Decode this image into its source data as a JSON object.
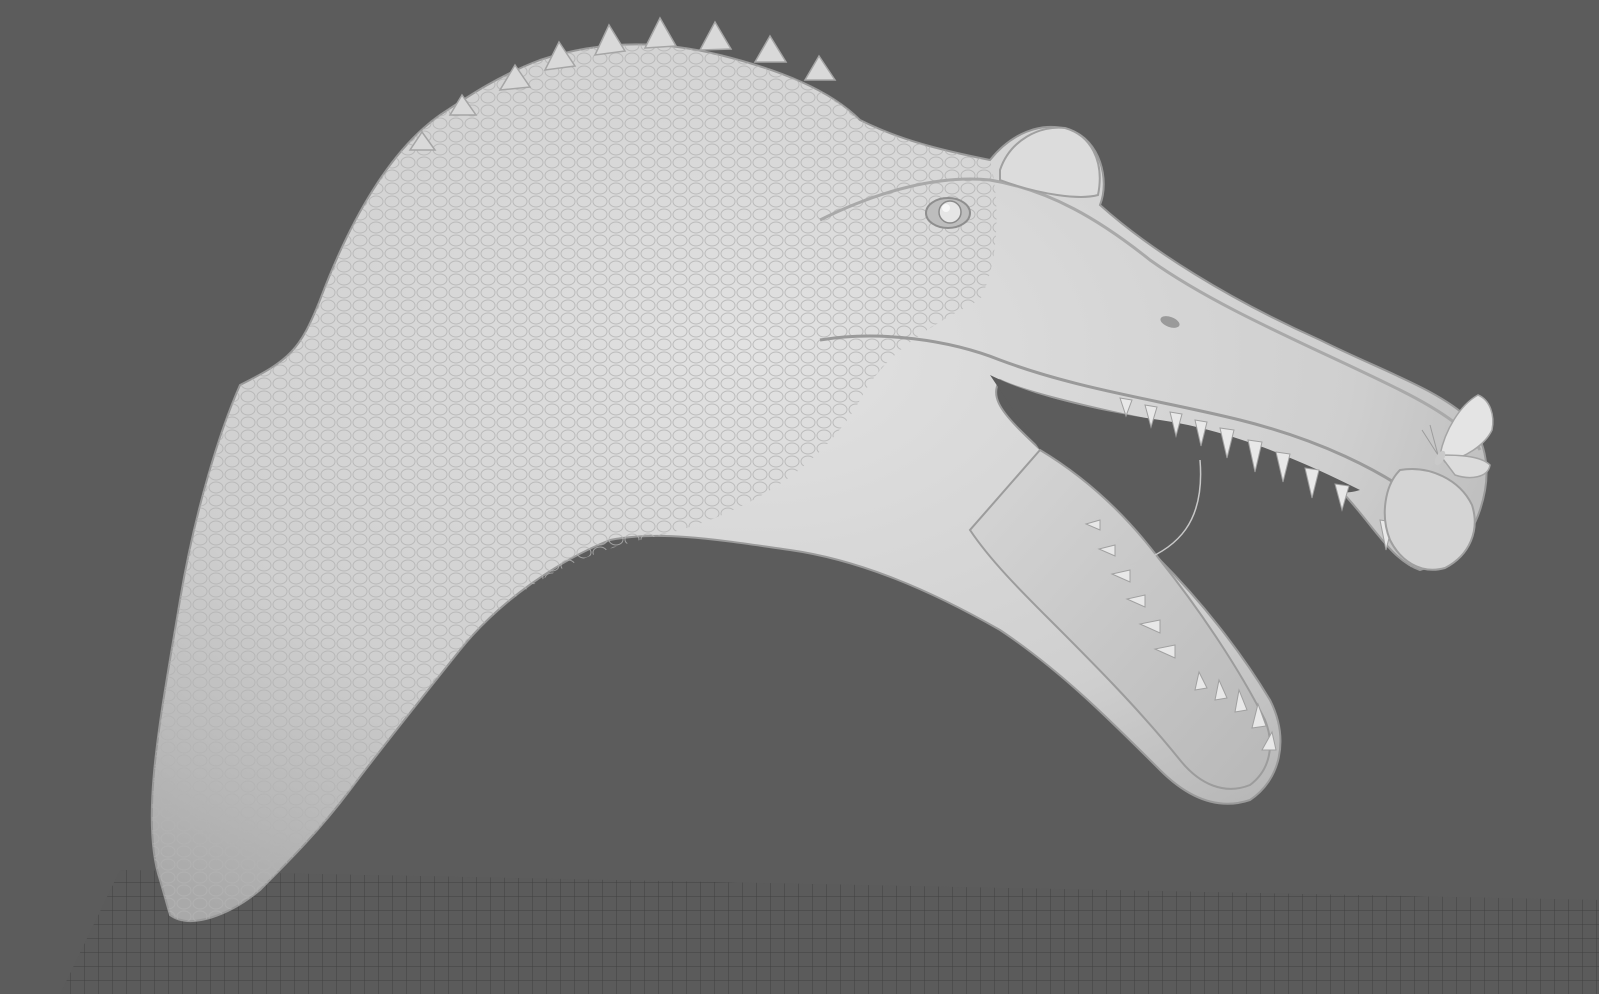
{
  "viewport": {
    "background": "#5c5c5c",
    "grid_color": "#2f2f2f",
    "model_color": "#d2d2d2",
    "shade_color": "#9f9f9f"
  },
  "scene": {
    "subject_icon": "spinosaurus-head-sculpt-icon",
    "secondary_icon": "butterfly-icon",
    "grid_icon": "ground-grid-icon"
  }
}
